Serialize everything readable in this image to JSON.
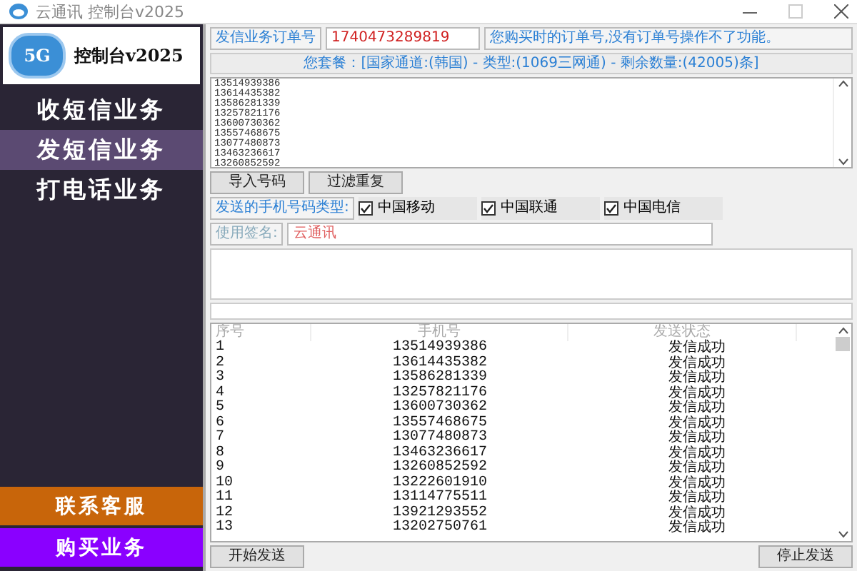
{
  "window": {
    "title": "云通讯 控制台v2025"
  },
  "sidebar": {
    "logo": {
      "badge": "5G",
      "title": "控制台v2025"
    },
    "items": [
      {
        "label": "收短信业务",
        "selected": false
      },
      {
        "label": "发短信业务",
        "selected": true
      },
      {
        "label": "打电话业务",
        "selected": false
      }
    ],
    "footer_buttons": [
      {
        "label": "联系客服",
        "color": "#c8650a"
      },
      {
        "label": "购买业务",
        "color": "#8a00ff"
      }
    ]
  },
  "order": {
    "label": "发信业务订单号",
    "value": "1740473289819",
    "hint": "您购买时的订单号,没有订单号操作不了功能。"
  },
  "package_info": "您套餐：[国家通道:(韩国) - 类型:(1069三网通) - 剩余数量:(42005)条]",
  "numbers": [
    "13514939386",
    "13614435382",
    "13586281339",
    "13257821176",
    "13600730362",
    "13557468675",
    "13077480873",
    "13463236617",
    "13260852592"
  ],
  "top_buttons": [
    "导入号码",
    "过滤重复"
  ],
  "carrier_filter": {
    "label": "发送的手机号码类型:",
    "options": [
      {
        "label": "中国移动",
        "checked": true
      },
      {
        "label": "中国联通",
        "checked": true
      },
      {
        "label": "中国电信",
        "checked": true
      }
    ]
  },
  "signature": {
    "label": "使用签名:",
    "value": "云通讯"
  },
  "table": {
    "columns": [
      "序号",
      "手机号",
      "发送状态"
    ],
    "rows": [
      [
        "1",
        "13514939386",
        "发信成功"
      ],
      [
        "2",
        "13614435382",
        "发信成功"
      ],
      [
        "3",
        "13586281339",
        "发信成功"
      ],
      [
        "4",
        "13257821176",
        "发信成功"
      ],
      [
        "5",
        "13600730362",
        "发信成功"
      ],
      [
        "6",
        "13557468675",
        "发信成功"
      ],
      [
        "7",
        "13077480873",
        "发信成功"
      ],
      [
        "8",
        "13463236617",
        "发信成功"
      ],
      [
        "9",
        "13260852592",
        "发信成功"
      ],
      [
        "10",
        "13222601910",
        "发信成功"
      ],
      [
        "11",
        "13114775511",
        "发信成功"
      ],
      [
        "12",
        "13921293552",
        "发信成功"
      ],
      [
        "13",
        "13202750761",
        "发信成功"
      ]
    ]
  },
  "bottom_buttons": {
    "start": "开始发送",
    "stop": "停止发送"
  }
}
